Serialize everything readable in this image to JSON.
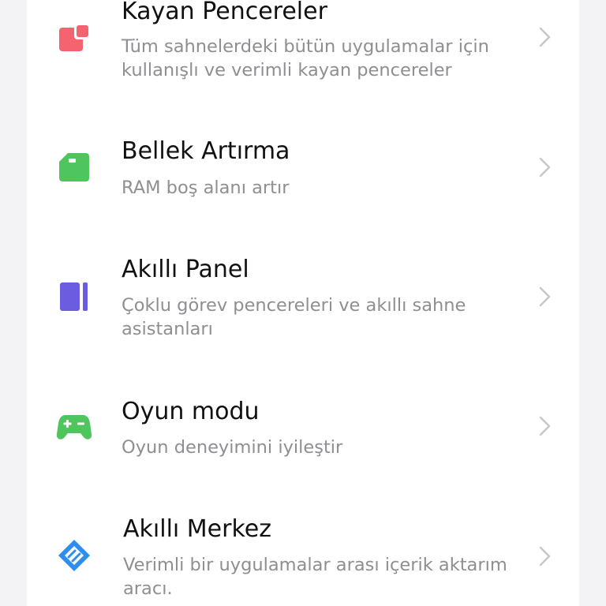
{
  "items": [
    {
      "title": "Kayan Pencereler",
      "description": "Tüm sahnelerdeki bütün uygulamalar için kullanışlı ve verimli kayan pencereler",
      "icon": "floating-window-icon",
      "color": "#f4636f"
    },
    {
      "title": "Bellek Artırma",
      "description": "RAM boş alanı artır",
      "icon": "memory-card-icon",
      "color": "#4fc55d"
    },
    {
      "title": "Akıllı Panel",
      "description": "Çoklu görev pencereleri ve akıllı sahne asistanları",
      "icon": "smart-sidebar-icon",
      "color": "#6b5ce0"
    },
    {
      "title": "Oyun modu",
      "description": "Oyun deneyimini iyileştir",
      "icon": "gamepad-icon",
      "color": "#4fc55d"
    },
    {
      "title": "Akıllı Merkez",
      "description": "Verimli bir uygulamalar arası içerik aktarım aracı.",
      "icon": "smart-hub-icon",
      "color": "#2e8ef0"
    }
  ]
}
